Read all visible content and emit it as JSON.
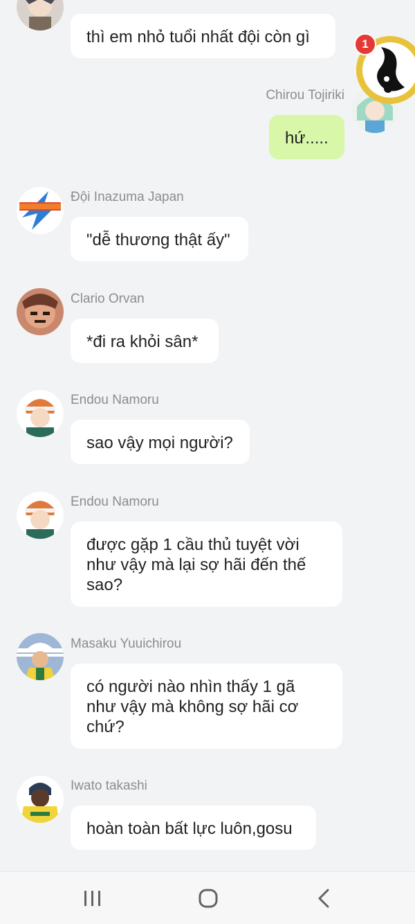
{
  "messages": [
    {
      "sender": "",
      "lines": [
        "thì em nhỏ tuổi nhất đội còn gì"
      ]
    },
    {
      "sender": "Chirou Tojiriki",
      "lines": [
        "hứ....."
      ],
      "mine": true
    },
    {
      "sender": "Đội Inazuma Japan",
      "lines": [
        "\"dễ thương thật ấy\""
      ]
    },
    {
      "sender": "Clario Orvan",
      "lines": [
        "*đi ra khỏi sân*"
      ]
    },
    {
      "sender": "Endou Namoru",
      "lines": [
        "sao vậy mọi người?"
      ]
    },
    {
      "sender": "Endou Namoru",
      "lines": [
        "được gặp 1 cầu thủ tuyệt vời",
        "như vậy mà lại sợ hãi đến thế",
        "sao?"
      ]
    },
    {
      "sender": "Masaku Yuuichirou",
      "lines": [
        "có người nào nhìn thấy 1 gã",
        "như vậy mà không sợ hãi cơ",
        "chứ?"
      ]
    },
    {
      "sender": "Iwato takashi",
      "lines": [
        "hoàn toàn bất lực luôn,gosu"
      ]
    }
  ],
  "floating_chat_head": {
    "badge": "1"
  },
  "navbar": {
    "icons": [
      "recent-apps-icon",
      "home-icon",
      "back-icon"
    ]
  },
  "colors": {
    "background": "#f2f3f5",
    "bubble": "#ffffff",
    "own_bubble": "#d8f7a8",
    "sender": "#8a8d91",
    "badge": "#e53935"
  }
}
